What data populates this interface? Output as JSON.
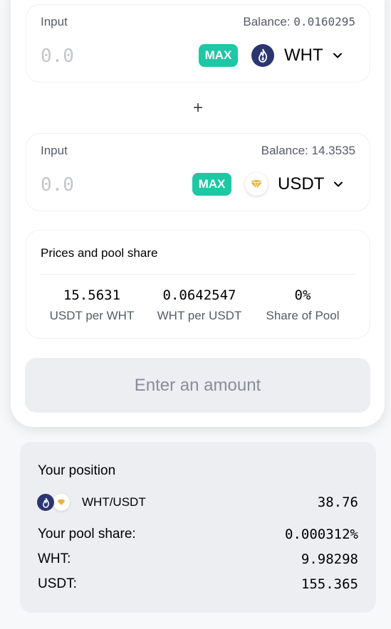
{
  "colors": {
    "accent": "#1dc8a4",
    "wht_token": "#2b3671",
    "usdt_token": "#e7b33c"
  },
  "input_a": {
    "label": "Input",
    "balance_label": "Balance:",
    "balance_value": "0.0160295",
    "placeholder": "0.0",
    "max_label": "MAX",
    "token_symbol": "WHT",
    "token_icon": "wht-flame-icon"
  },
  "plus": "+",
  "input_b": {
    "label": "Input",
    "balance_label": "Balance:",
    "balance_value": "14.3535",
    "placeholder": "0.0",
    "max_label": "MAX",
    "token_symbol": "USDT",
    "token_icon": "usdt-diamond-icon"
  },
  "prices": {
    "title": "Prices and pool share",
    "items": [
      {
        "value": "15.5631",
        "label": "USDT per WHT"
      },
      {
        "value": "0.0642547",
        "label": "WHT per USDT"
      },
      {
        "value": "0%",
        "label": "Share of Pool"
      }
    ]
  },
  "submit_label": "Enter an amount",
  "position": {
    "title": "Your position",
    "pair": "WHT/USDT",
    "pair_amount": "38.76",
    "rows": [
      {
        "label": "Your pool share:",
        "value": "0.000312%"
      },
      {
        "label": "WHT:",
        "value": "9.98298"
      },
      {
        "label": "USDT:",
        "value": "155.365"
      }
    ]
  }
}
